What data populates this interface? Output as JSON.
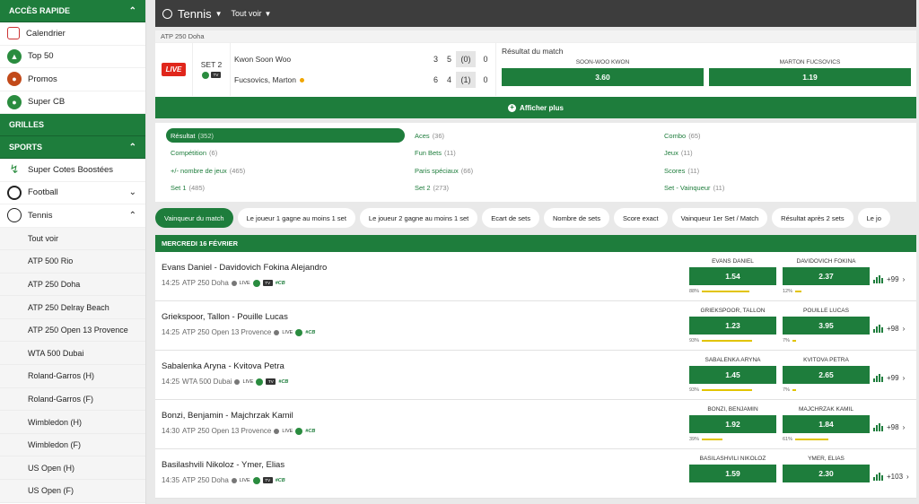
{
  "sidebar": {
    "quick_access": {
      "title": "ACCÈS RAPIDE",
      "items": [
        "Calendrier",
        "Top 50",
        "Promos",
        "Super CB"
      ]
    },
    "grids_title": "GRILLES",
    "sports_title": "SPORTS",
    "sports_items": [
      "Super Cotes Boostées",
      "Football",
      "Tennis"
    ],
    "tennis_sub": [
      "Tout voir",
      "ATP 500 Rio",
      "ATP 250 Doha",
      "ATP 250 Delray Beach",
      "ATP 250 Open 13 Provence",
      "WTA 500 Dubai",
      "Roland-Garros (H)",
      "Roland-Garros (F)",
      "Wimbledon (H)",
      "Wimbledon (F)",
      "US Open (H)",
      "US Open (F)"
    ]
  },
  "header": {
    "title": "Tennis",
    "view_all": "Tout voir"
  },
  "live_match": {
    "competition": "ATP 250 Doha",
    "badge": "LIVE",
    "set_label": "SET 2",
    "tv_label": "TV",
    "players": [
      {
        "name": "Kwon Soon Woo",
        "set1": "3",
        "set2": "5",
        "current": "(0)",
        "points": "0"
      },
      {
        "name": "Fucsovics, Marton",
        "set1": "6",
        "set2": "4",
        "current": "(1)",
        "points": "0"
      }
    ],
    "market_title": "Résultat du match",
    "odds": [
      {
        "name": "SOON-WOO KWON",
        "value": "3.60"
      },
      {
        "name": "MARTON FUCSOVICS",
        "value": "1.19"
      }
    ],
    "show_more": "Afficher plus"
  },
  "markets": [
    {
      "label": "Résultat",
      "count": "(352)",
      "active": true
    },
    {
      "label": "Aces",
      "count": "(36)"
    },
    {
      "label": "Combo",
      "count": "(65)"
    },
    {
      "label": "Compétition",
      "count": "(6)"
    },
    {
      "label": "Fun Bets",
      "count": "(11)"
    },
    {
      "label": "Jeux",
      "count": "(11)"
    },
    {
      "label": "+/- nombre de jeux",
      "count": "(465)"
    },
    {
      "label": "Paris spéciaux",
      "count": "(66)"
    },
    {
      "label": "Scores",
      "count": "(11)"
    },
    {
      "label": "Set 1",
      "count": "(485)"
    },
    {
      "label": "Set 2",
      "count": "(273)"
    },
    {
      "label": "Set - Vainqueur",
      "count": "(11)"
    }
  ],
  "chips": [
    "Vainqueur du match",
    "Le joueur 1 gagne au moins 1 set",
    "Le joueur 2 gagne au moins 1 set",
    "Ecart de sets",
    "Nombre de sets",
    "Score exact",
    "Vainqueur 1er Set / Match",
    "Résultat après 2 sets",
    "Le jo"
  ],
  "day_header": "MERCREDI 16 FÉVRIER",
  "events": [
    {
      "name": "Evans Daniel - Davidovich Fokina Alejandro",
      "time": "14:25",
      "competition": "ATP 250 Doha",
      "live": "LIVE",
      "tv": "TV",
      "cb": "#CB",
      "o1_name": "EVANS DANIEL",
      "o1": "1.54",
      "p1": "88%",
      "p1v": 88,
      "o2_name": "DAVIDOVICH FOKINA",
      "o2": "2.37",
      "p2": "12%",
      "p2v": 12,
      "more": "+99"
    },
    {
      "name": "Griekspoor, Tallon - Pouille Lucas",
      "time": "14:25",
      "competition": "ATP 250 Open 13 Provence",
      "live": "LIVE",
      "tv": "",
      "cb": "#CB",
      "o1_name": "GRIEKSPOOR, TALLON",
      "o1": "1.23",
      "p1": "93%",
      "p1v": 93,
      "o2_name": "POUILLE LUCAS",
      "o2": "3.95",
      "p2": "7%",
      "p2v": 7,
      "more": "+98"
    },
    {
      "name": "Sabalenka Aryna - Kvitova Petra",
      "time": "14:25",
      "competition": "WTA 500 Dubai",
      "live": "LIVE",
      "tv": "TV",
      "cb": "#CB",
      "o1_name": "SABALENKA ARYNA",
      "o1": "1.45",
      "p1": "93%",
      "p1v": 93,
      "o2_name": "KVITOVA PETRA",
      "o2": "2.65",
      "p2": "7%",
      "p2v": 7,
      "more": "+99"
    },
    {
      "name": "Bonzi, Benjamin - Majchrzak Kamil",
      "time": "14:30",
      "competition": "ATP 250 Open 13 Provence",
      "live": "LIVE",
      "tv": "",
      "cb": "#CB",
      "o1_name": "BONZI, BENJAMIN",
      "o1": "1.92",
      "p1": "39%",
      "p1v": 39,
      "o2_name": "MAJCHRZAK KAMIL",
      "o2": "1.84",
      "p2": "61%",
      "p2v": 61,
      "more": "+98"
    },
    {
      "name": "Basilashvili Nikoloz - Ymer, Elias",
      "time": "14:35",
      "competition": "ATP 250 Doha",
      "live": "LIVE",
      "tv": "TV",
      "cb": "#CB",
      "o1_name": "BASILASHVILI NIKOLOZ",
      "o1": "1.59",
      "p1": "",
      "p1v": 0,
      "o2_name": "YMER, ELIAS",
      "o2": "2.30",
      "p2": "",
      "p2v": 0,
      "more": "+103"
    }
  ],
  "colors": {
    "brand": "#1e7d3c",
    "header": "#3d3d3d",
    "live": "#e0261b",
    "bar": "#e2c400"
  }
}
